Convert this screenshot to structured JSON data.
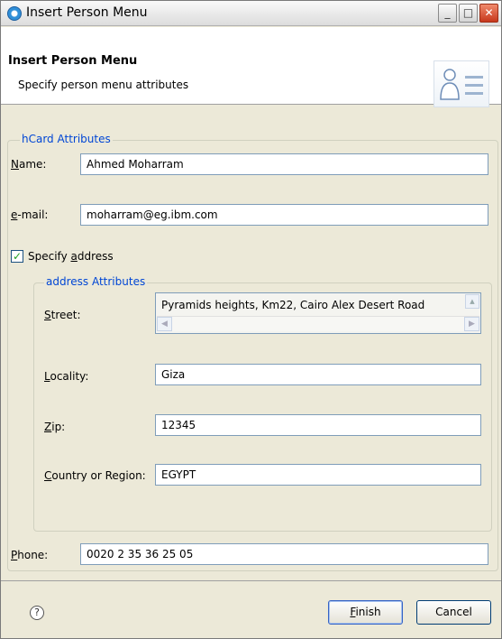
{
  "window": {
    "title": "Insert Person Menu",
    "min_glyph": "_",
    "max_glyph": "□",
    "close_glyph": "✕"
  },
  "banner": {
    "title": "Insert Person Menu",
    "subtitle": "Specify person menu attributes"
  },
  "hcard": {
    "group_label": "hCard Attributes",
    "name_label": "Name:",
    "name_value": "Ahmed Moharram",
    "email_label": "e-mail:",
    "email_value": "moharram@eg.ibm.com",
    "specify_address_label": "Specify address",
    "specify_address_checked": true,
    "phone_label": "Phone:",
    "phone_value": "0020 2 35 36 25 05"
  },
  "address": {
    "group_label": "address Attributes",
    "street_label": "Street:",
    "street_value": "Pyramids heights, Km22, Cairo Alex Desert Road",
    "locality_label": "Locality:",
    "locality_value": "Giza",
    "zip_label": "Zip:",
    "zip_value": "12345",
    "country_label": "Country or Region:",
    "country_value": "EGYPT"
  },
  "footer": {
    "finish_label": "Finish",
    "cancel_label": "Cancel",
    "help_glyph": "?"
  },
  "icons": {
    "app": "eclipse-app-icon",
    "banner": "person-menu-icon",
    "help": "help-icon"
  }
}
